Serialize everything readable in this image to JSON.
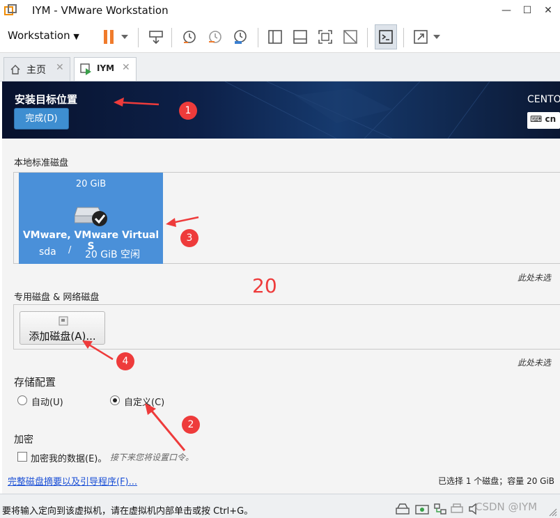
{
  "window": {
    "title": "IYM - VMware Workstation",
    "minimize": "—",
    "maximize": "☐",
    "close": "✕"
  },
  "toolbar": {
    "menu_label": "Workstation"
  },
  "tabs": [
    {
      "label": "主页"
    },
    {
      "label": "IYM"
    }
  ],
  "installer": {
    "title": "安装目标位置",
    "done_button": "完成(D)",
    "os_label": "CENTO",
    "keyboard_layout": "cn",
    "local_disks_heading": "本地标准磁盘",
    "disk": {
      "size": "20 GiB",
      "name": "VMware, VMware Virtual S",
      "device": "sda",
      "separator": "/",
      "free": "20 GiB 空闲"
    },
    "not_selected_note": "此处未选",
    "special_disks_heading": "专用磁盘 & 网络磁盘",
    "add_disk_button": "添加磁盘(A)...",
    "storage_heading": "存储配置",
    "radio_auto": "自动(U)",
    "radio_custom": "自定义(C)",
    "encryption_heading": "加密",
    "encrypt_checkbox": "加密我的数据(E)。",
    "encrypt_hint": "接下来您将设置口令。",
    "summary_link": "完整磁盘摘要以及引导程序(F)...",
    "selection_summary": "已选择 1 个磁盘；容量 20 GiB"
  },
  "annotations": {
    "badge1": "1",
    "badge2": "2",
    "badge3": "3",
    "badge4": "4",
    "note": "20"
  },
  "statusbar": {
    "message": "要将输入定向到该虚拟机，请在虚拟机内部单击或按 Ctrl+G。",
    "watermark": "CSDN @IYM"
  },
  "colors": {
    "accent": "#4a90d9",
    "annotation": "#ee3b3b",
    "button": "#3e8ed1"
  }
}
